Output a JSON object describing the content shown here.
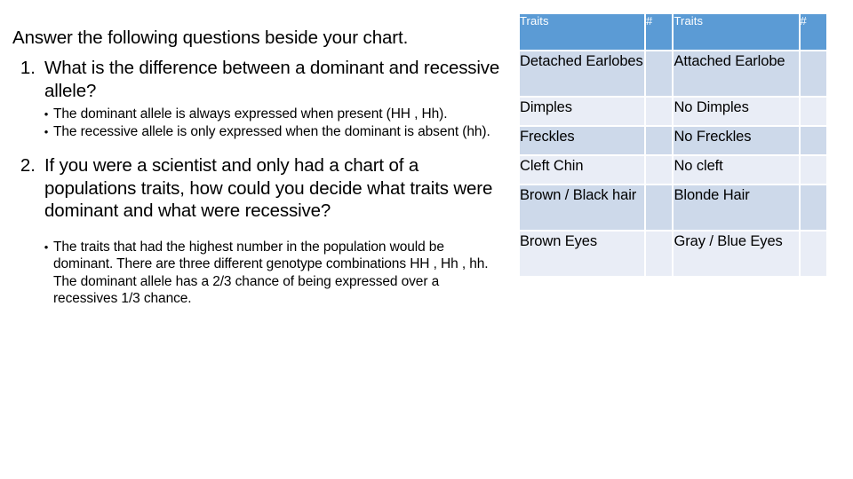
{
  "slide": {
    "intro": "Answer the following questions beside your chart.",
    "questions": [
      {
        "number": "1.",
        "text": "What is the difference between a dominant and recessive allele?",
        "bullet_symbol": "•",
        "bullets": [
          "The dominant allele is always expressed when present (HH , Hh).",
          "The recessive allele is only expressed when the dominant is absent (hh)."
        ]
      },
      {
        "number": "2.",
        "text": "If you were a scientist and only had a chart of a populations traits, how could you decide what traits were dominant and what were recessive?",
        "bullet_symbol": "•",
        "bullets": [
          "The traits that had the highest number in the population would be dominant. There are three different genotype combinations HH , Hh , hh. The dominant allele has a 2/3 chance of being expressed over a recessives 1/3 chance."
        ]
      }
    ]
  },
  "table": {
    "headers": [
      "Traits",
      "#",
      "Traits",
      "#"
    ],
    "rows": [
      {
        "dominant_trait": "Detached Earlobes",
        "dominant_count": "",
        "recessive_trait": "Attached Earlobe",
        "recessive_count": ""
      },
      {
        "dominant_trait": "Dimples",
        "dominant_count": "",
        "recessive_trait": "No Dimples",
        "recessive_count": ""
      },
      {
        "dominant_trait": "Freckles",
        "dominant_count": "",
        "recessive_trait": "No Freckles",
        "recessive_count": ""
      },
      {
        "dominant_trait": "Cleft Chin",
        "dominant_count": "",
        "recessive_trait": "No cleft",
        "recessive_count": ""
      },
      {
        "dominant_trait": "Brown / Black hair",
        "dominant_count": "",
        "recessive_trait": "Blonde Hair",
        "recessive_count": ""
      },
      {
        "dominant_trait": "Brown Eyes",
        "dominant_count": "",
        "recessive_trait": "Gray / Blue Eyes",
        "recessive_count": ""
      }
    ]
  },
  "colors": {
    "header_fill": "#5b9bd5",
    "header_text": "#ffffff",
    "row_dark": "#cdd9ea",
    "row_light": "#e9edf6",
    "page_background": "#ffffff",
    "body_text": "#000000"
  }
}
